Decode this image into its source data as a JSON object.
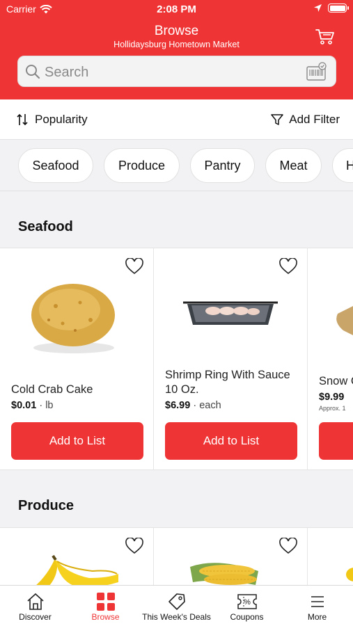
{
  "status": {
    "carrier": "Carrier",
    "time": "2:08 PM"
  },
  "header": {
    "title": "Browse",
    "store": "Hollidaysburg Hometown Market"
  },
  "search": {
    "placeholder": "Search"
  },
  "sortbar": {
    "sort_label": "Popularity",
    "filter_label": "Add Filter"
  },
  "categories": [
    "Seafood",
    "Produce",
    "Pantry",
    "Meat",
    "H"
  ],
  "sections": [
    {
      "title": "Seafood",
      "products": [
        {
          "name": "Cold Crab Cake",
          "price": "$0.01",
          "unit": "lb",
          "button": "Add to List"
        },
        {
          "name": "Shrimp Ring With Sauce 10 Oz.",
          "price": "$6.99",
          "unit": "each",
          "button": "Add to List"
        },
        {
          "name": "Snow C",
          "price": "$9.99",
          "unit": "",
          "note": "Approx. 1",
          "button": ""
        }
      ]
    },
    {
      "title": "Produce"
    }
  ],
  "tabs": [
    {
      "label": "Discover",
      "icon": "home-icon"
    },
    {
      "label": "Browse",
      "icon": "grid-icon"
    },
    {
      "label": "This Week's Deals",
      "icon": "tag-icon"
    },
    {
      "label": "Coupons",
      "icon": "coupon-icon"
    },
    {
      "label": "More",
      "icon": "menu-icon"
    }
  ],
  "colors": {
    "accent": "#ef3435"
  }
}
